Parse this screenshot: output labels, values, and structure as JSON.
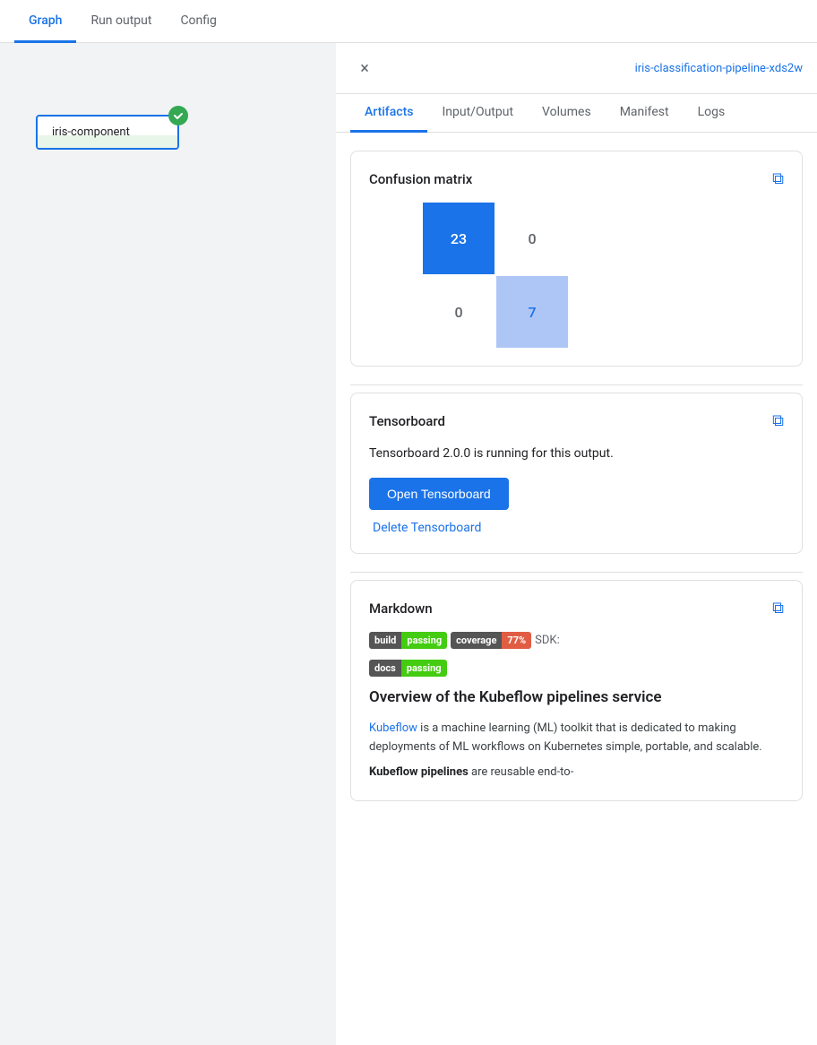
{
  "top_tabs": [
    {
      "label": "Graph",
      "active": true
    },
    {
      "label": "Run output",
      "active": false
    },
    {
      "label": "Config",
      "active": false
    }
  ],
  "graph_node": {
    "label": "iris-component",
    "check_icon": "✓"
  },
  "panel": {
    "close_icon": "×",
    "pipeline_id": "iris-classification-pipeline-xds2w",
    "tabs": [
      {
        "label": "Artifacts",
        "active": true
      },
      {
        "label": "Input/Output",
        "active": false
      },
      {
        "label": "Volumes",
        "active": false
      },
      {
        "label": "Manifest",
        "active": false
      },
      {
        "label": "Logs",
        "active": false
      }
    ]
  },
  "confusion_matrix": {
    "title": "Confusion matrix",
    "external_link_icon": "⧉",
    "cells": [
      {
        "value": "23",
        "type": "blue-dark"
      },
      {
        "value": "0",
        "type": "empty"
      },
      {
        "value": "0",
        "type": "empty"
      },
      {
        "value": "7",
        "type": "blue-light"
      }
    ]
  },
  "tensorboard": {
    "title": "Tensorboard",
    "external_link_icon": "⧉",
    "description": "Tensorboard 2.0.0 is running for this output.",
    "open_button": "Open Tensorboard",
    "delete_link": "Delete Tensorboard"
  },
  "markdown": {
    "title": "Markdown",
    "external_link_icon": "⧉",
    "badges": [
      {
        "left": "build",
        "right": "passing",
        "right_color": "green"
      },
      {
        "left": "coverage",
        "right": "77%",
        "right_color": "orange"
      }
    ],
    "sdk_label": "SDK:",
    "docs_badge": {
      "left": "docs",
      "right": "passing",
      "right_color": "green"
    },
    "heading": "Overview of the Kubeflow pipelines service",
    "link_text": "Kubeflow",
    "link_href": "#",
    "paragraph1": " is a machine learning (ML) toolkit that is dedicated to making deployments of ML workflows on Kubernetes simple, portable, and scalable.",
    "paragraph2_prefix": "Kubeflow pipelines",
    "paragraph2_suffix": " are reusable end-to-"
  }
}
